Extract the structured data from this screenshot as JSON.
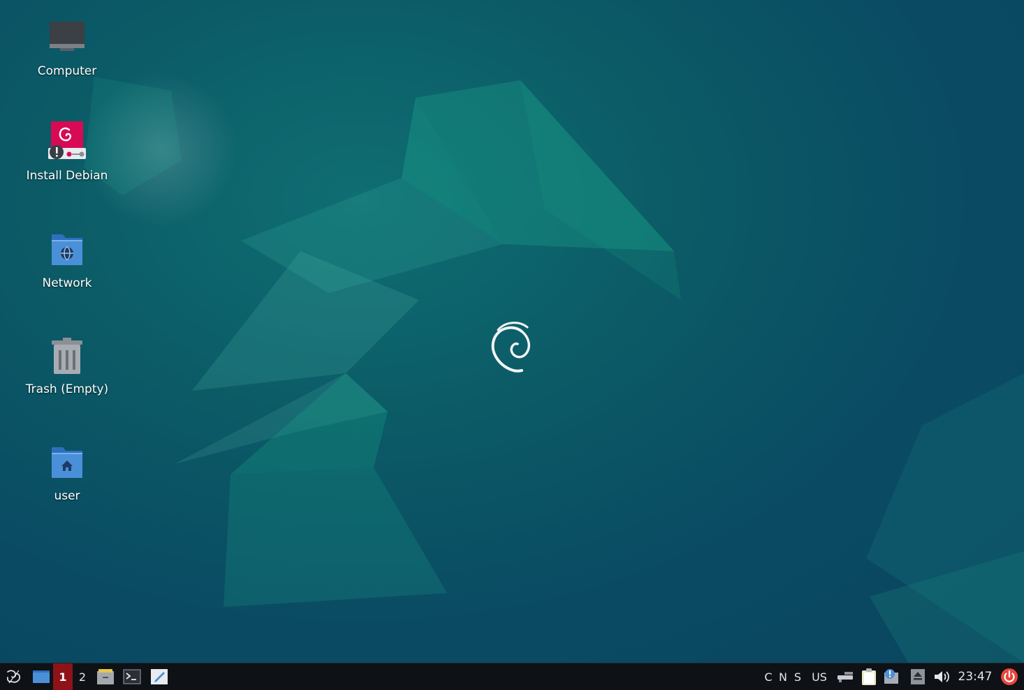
{
  "desktop": {
    "icons": [
      {
        "label": "Computer",
        "icon": "computer-icon"
      },
      {
        "label": "Install Debian",
        "icon": "install-debian-icon"
      },
      {
        "label": "Network",
        "icon": "network-folder-icon"
      },
      {
        "label": "Trash (Empty)",
        "icon": "trash-icon"
      },
      {
        "label": "user",
        "icon": "home-folder-icon"
      }
    ]
  },
  "taskbar": {
    "launchers": [
      {
        "icon": "applications-menu-icon"
      },
      {
        "icon": "show-desktop-icon"
      },
      {
        "icon": "file-manager-icon"
      },
      {
        "icon": "terminal-icon"
      },
      {
        "icon": "text-editor-icon"
      }
    ],
    "workspaces": [
      "1",
      "2"
    ],
    "active_workspace": "1",
    "lock_keys": [
      "C",
      "N",
      "S"
    ],
    "keyboard_layout": "US",
    "clock": "23:47",
    "tray_icons": [
      "network-wired-icon",
      "clipboard-icon",
      "notification-icon",
      "eject-icon",
      "volume-icon",
      "power-icon"
    ]
  },
  "colors": {
    "wallpaper_base": "#0a4b63",
    "wallpaper_accent": "#1fa98a",
    "taskbar_bg": "#0e1116",
    "active_workspace": "#8e1318",
    "folder_blue": "#4a90d9",
    "debian_red": "#d70a53",
    "power_red": "#e8463c"
  }
}
